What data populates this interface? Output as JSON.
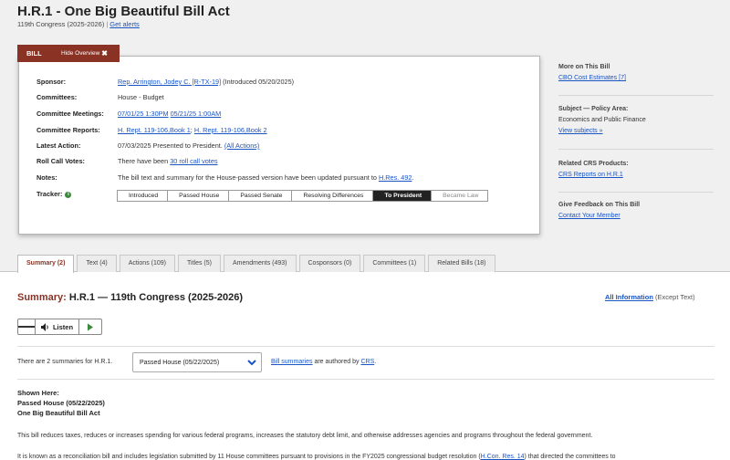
{
  "header": {
    "title": "H.R.1 - One Big Beautiful Bill Act",
    "congress": "119th Congress (2025-2026)",
    "separator": "|",
    "alerts_link": "Get alerts"
  },
  "overview": {
    "tab_label": "BILL",
    "hide_label": "Hide Overview",
    "hide_icon": "✖",
    "rows": {
      "sponsor": {
        "label": "Sponsor:",
        "link": "Rep. Arrington, Jodey C. [R-TX-19]",
        "tail": " (Introduced 05/20/2025)"
      },
      "committees": {
        "label": "Committees:",
        "value": "House - Budget"
      },
      "meetings": {
        "label": "Committee Meetings:",
        "link1": "07/01/25 1:30PM",
        "link2": "05/21/25 1:00AM"
      },
      "reports": {
        "label": "Committee Reports:",
        "link1": "H. Rept. 119-106,Book 1",
        "sep": "; ",
        "link2": "H. Rept. 119-106,Book 2"
      },
      "latest": {
        "label": "Latest Action:",
        "value": "07/03/2025 Presented to President.",
        "link": "(All Actions)"
      },
      "rollcall": {
        "label": "Roll Call Votes:",
        "prefix": "There have been ",
        "link": "30 roll call votes"
      },
      "notes": {
        "label": "Notes:",
        "text": "The bill text and summary for the House-passed version have been updated pursuant to ",
        "link": "H.Res. 492",
        "suffix": "."
      },
      "tracker": {
        "label": "Tracker:",
        "icon": "info-icon"
      }
    },
    "tracker_steps": [
      "Introduced",
      "Passed House",
      "Passed Senate",
      "Resolving Differences",
      "To President",
      "Became Law"
    ],
    "tracker_current": "To President"
  },
  "sidebar": {
    "more": {
      "heading": "More on This Bill",
      "link": "CBO Cost Estimates [7]"
    },
    "subject": {
      "heading": "Subject — Policy Area:",
      "value": "Economics and Public Finance",
      "link": "View subjects »"
    },
    "crs": {
      "heading": "Related CRS Products:",
      "link": "CRS Reports on H.R.1"
    },
    "feedback": {
      "heading": "Give Feedback on This Bill",
      "link": "Contact Your Member"
    }
  },
  "tabs": [
    {
      "label": "Summary (2)",
      "active": true
    },
    {
      "label": "Text (4)"
    },
    {
      "label": "Actions (109)"
    },
    {
      "label": "Titles (5)"
    },
    {
      "label": "Amendments (493)"
    },
    {
      "label": "Cosponsors (0)"
    },
    {
      "label": "Committees (1)"
    },
    {
      "label": "Related Bills (18)"
    }
  ],
  "summary": {
    "heading_prefix": "Summary:",
    "heading_rest": " H.R.1 — 119th Congress (2025-2026)",
    "all_info_link": "All Information",
    "all_info_tail": " (Except Text)",
    "listen_label": "Listen",
    "count_text": "There are 2 summaries for H.R.1.",
    "selected_version": "Passed House (05/22/2025)",
    "authored_link": "Bill summaries",
    "authored_mid": " are authored by ",
    "crs_link": "CRS",
    "authored_end": ".",
    "shown_here": "Shown Here:",
    "shown_version": "Passed House (05/22/2025)",
    "shown_title": "One Big Beautiful Bill Act",
    "para1": "This bill reduces taxes, reduces or increases spending for various federal programs, increases the statutory debt limit, and otherwise addresses agencies and programs throughout the federal government.",
    "para2_a": "It is known as a reconciliation bill and includes legislation submitted by 11 House committees pursuant to provisions in the FY2025 congressional budget resolution (",
    "para2_link": "H.Con. Res. 14",
    "para2_b": ") that directed the committees to"
  }
}
